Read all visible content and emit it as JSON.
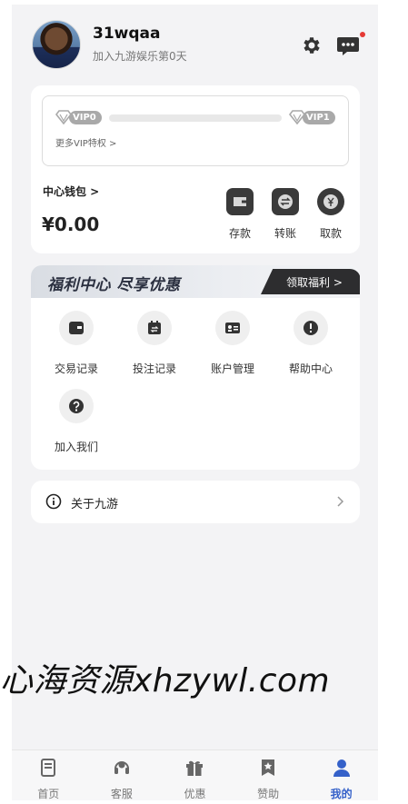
{
  "profile": {
    "username": "31wqaa",
    "joined_text": "加入九游娱乐第0天"
  },
  "header_icons": [
    "gear-icon",
    "message-icon"
  ],
  "vip": {
    "current_level": "VIP0",
    "next_level": "VIP1",
    "progress": 0,
    "more_label": "更多VIP特权 >"
  },
  "wallet": {
    "title": "中心钱包 >",
    "balance": "¥0.00",
    "buttons": [
      {
        "label": "存款",
        "icon": "wallet-icon"
      },
      {
        "label": "转账",
        "icon": "transfer-icon"
      },
      {
        "label": "取款",
        "icon": "yen-icon"
      }
    ]
  },
  "welfare": {
    "title": "福利中心 尽享优惠",
    "claim_label": "领取福利 >",
    "items": [
      {
        "label": "交易记录",
        "icon": "wallet-icon"
      },
      {
        "label": "投注记录",
        "icon": "calendar-icon"
      },
      {
        "label": "账户管理",
        "icon": "id-card-icon"
      },
      {
        "label": "帮助中心",
        "icon": "exclamation-icon"
      },
      {
        "label": "加入我们",
        "icon": "question-icon"
      }
    ]
  },
  "about": {
    "label": "关于九游"
  },
  "watermark": "心海资源xhzywl.com",
  "tabs": [
    {
      "label": "首页",
      "icon": "home-icon",
      "active": false
    },
    {
      "label": "客服",
      "icon": "headset-icon",
      "active": false
    },
    {
      "label": "优惠",
      "icon": "gift-icon",
      "active": false
    },
    {
      "label": "赞助",
      "icon": "bookmark-star-icon",
      "active": false
    },
    {
      "label": "我的",
      "icon": "user-icon",
      "active": true
    }
  ],
  "colors": {
    "accent": "#3561c9",
    "notification_dot": "#e53935",
    "claim_button_bg": "#2d2d2f"
  }
}
